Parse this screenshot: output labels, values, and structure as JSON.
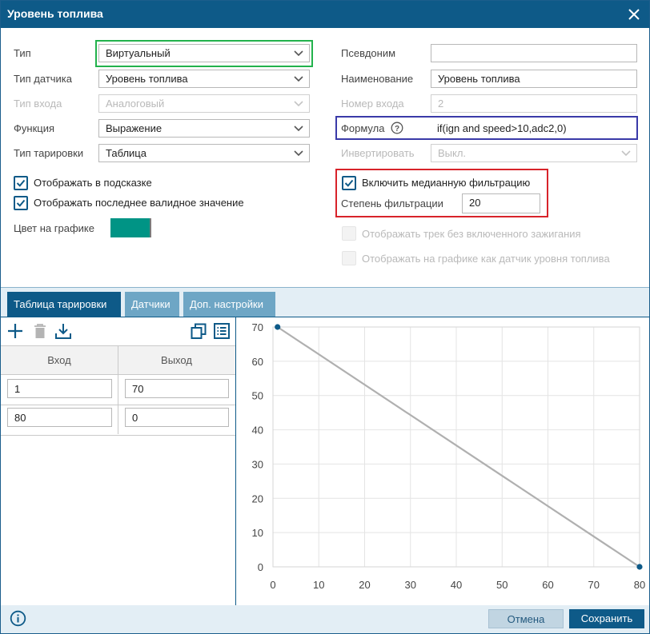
{
  "dialog": {
    "title": "Уровень топлива",
    "icons": {
      "close": "close-icon",
      "info": "info-icon",
      "help": "question-circle-icon"
    }
  },
  "left_fields": [
    {
      "key": "type",
      "label": "Тип",
      "value": "Виртуальный",
      "disabled": false
    },
    {
      "key": "sensor_type",
      "label": "Тип датчика",
      "value": "Уровень топлива",
      "disabled": false
    },
    {
      "key": "input_type",
      "label": "Тип входа",
      "value": "Аналоговый",
      "disabled": true
    },
    {
      "key": "function",
      "label": "Функция",
      "value": "Выражение",
      "disabled": false
    },
    {
      "key": "calibration_type",
      "label": "Тип тарировки",
      "value": "Таблица",
      "disabled": false
    }
  ],
  "right_fields": {
    "alias": {
      "label": "Псевдоним",
      "value": ""
    },
    "name": {
      "label": "Наименование",
      "value": "Уровень топлива"
    },
    "input_number": {
      "label": "Номер входа",
      "value": "2"
    },
    "formula": {
      "label": "Формула",
      "value": "if(ign and speed>10,adc2,0)"
    },
    "invert": {
      "label": "Инвертировать",
      "value": "Выкл."
    }
  },
  "checkboxes_left": [
    {
      "label": "Отображать в подсказке",
      "checked": true
    },
    {
      "label": "Отображать последнее валидное значение",
      "checked": true
    }
  ],
  "color": {
    "label": "Цвет на графике",
    "value": "#009485"
  },
  "median_filter": {
    "label": "Включить медианную фильтрацию",
    "checked": true,
    "degree_label": "Степень фильтрации",
    "degree_value": "20"
  },
  "checkboxes_right_disabled": [
    {
      "label": "Отображать трек без включенного зажигания",
      "checked": false
    },
    {
      "label": "Отображать на графике как датчик уровня топлива",
      "checked": false
    }
  ],
  "highlight_colors": {
    "type": "#22b24c",
    "formula": "#3a3aa8",
    "median": "#d8232a"
  },
  "tabs": [
    {
      "label": "Таблица тарировки",
      "active": true
    },
    {
      "label": "Датчики",
      "active": false
    },
    {
      "label": "Доп. настройки",
      "active": false
    }
  ],
  "toolbar_icons": [
    "plus-icon",
    "trash-icon",
    "download-icon",
    "copy-icon",
    "list-icon"
  ],
  "calibration_table": {
    "columns": [
      "Вход",
      "Выход"
    ],
    "rows": [
      [
        "1",
        "70"
      ],
      [
        "80",
        "0"
      ]
    ]
  },
  "chart_data": {
    "type": "line",
    "x": [
      1,
      80
    ],
    "y": [
      70,
      0
    ],
    "xlim": [
      0,
      80
    ],
    "ylim": [
      0,
      70
    ],
    "xticks": [
      "0",
      "10",
      "20",
      "30",
      "40",
      "50",
      "60",
      "70",
      "80"
    ],
    "yticks": [
      "0",
      "10",
      "20",
      "30",
      "40",
      "50",
      "60",
      "70"
    ],
    "title": "",
    "xlabel": "",
    "ylabel": "",
    "grid": true,
    "line_color": "#b0b0b0",
    "point_color": "#0e5a88"
  },
  "footer": {
    "cancel_label": "Отмена",
    "save_label": "Сохранить"
  }
}
